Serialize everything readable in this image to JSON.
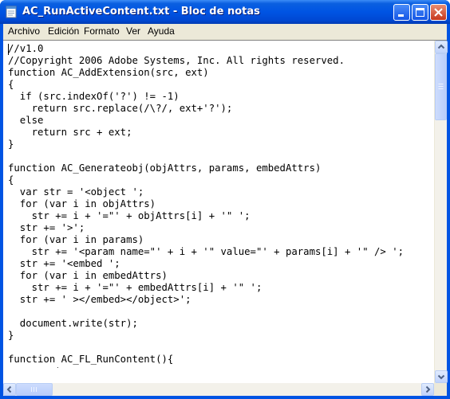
{
  "window": {
    "title": "AC_RunActiveContent.txt - Bloc de notas"
  },
  "menu": {
    "items": [
      {
        "label": "Archivo"
      },
      {
        "label": "Edición"
      },
      {
        "label": "Formato"
      },
      {
        "label": "Ver"
      },
      {
        "label": "Ayuda"
      }
    ]
  },
  "editor": {
    "content": "//v1.0\n//Copyright 2006 Adobe Systems, Inc. All rights reserved.\nfunction AC_AddExtension(src, ext)\n{\n  if (src.indexOf('?') != -1)\n    return src.replace(/\\?/, ext+'?');\n  else\n    return src + ext;\n}\n\nfunction AC_Generateobj(objAttrs, params, embedAttrs)\n{\n  var str = '<object ';\n  for (var i in objAttrs)\n    str += i + '=\"' + objAttrs[i] + '\" ';\n  str += '>';\n  for (var i in params)\n    str += '<param name=\"' + i + '\" value=\"' + params[i] + '\" /> ';\n  str += '<embed ';\n  for (var i in embedAttrs)\n    str += i + '=\"' + embedAttrs[i] + '\" ';\n  str += ' ></embed></object>';\n\n  document.write(str);\n}\n\nfunction AC_FL_RunContent(){\n  var ret ="
  },
  "icons": {
    "app": "notepad-icon",
    "minimize": "minimize-icon",
    "maximize": "maximize-icon",
    "close": "close-icon",
    "scroll_up": "arrow-up-icon",
    "scroll_down": "arrow-down-icon",
    "scroll_left": "arrow-left-icon",
    "scroll_right": "arrow-right-icon"
  },
  "colors": {
    "titlebar": "#0054e3",
    "menubar": "#ece9d8",
    "close_button": "#c6371d"
  }
}
